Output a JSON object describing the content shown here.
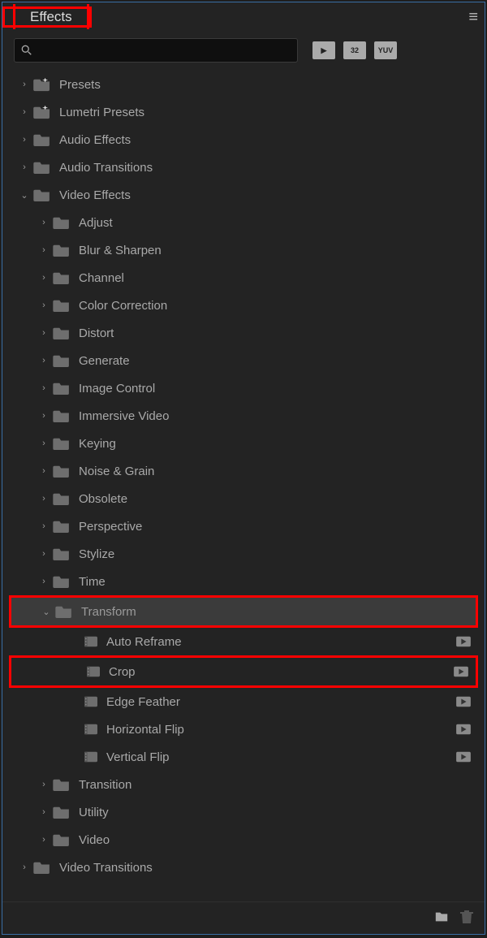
{
  "panel": {
    "title": "Effects"
  },
  "toolbar": {
    "search_value": "",
    "badges": {
      "fx": "▶",
      "b32": "32",
      "yuv": "YUV"
    }
  },
  "tree": {
    "presets": "Presets",
    "lumetri": "Lumetri Presets",
    "audio_effects": "Audio Effects",
    "audio_transitions": "Audio Transitions",
    "video_effects": "Video Effects",
    "ve": {
      "adjust": "Adjust",
      "blur": "Blur & Sharpen",
      "channel": "Channel",
      "color": "Color Correction",
      "distort": "Distort",
      "generate": "Generate",
      "image": "Image Control",
      "immersive": "Immersive Video",
      "keying": "Keying",
      "noise": "Noise & Grain",
      "obsolete": "Obsolete",
      "perspective": "Perspective",
      "stylize": "Stylize",
      "time": "Time",
      "transform": "Transform",
      "tf": {
        "auto_reframe": "Auto Reframe",
        "crop": "Crop",
        "edge_feather": "Edge Feather",
        "hflip": "Horizontal Flip",
        "vflip": "Vertical Flip"
      },
      "transition": "Transition",
      "utility": "Utility",
      "video": "Video"
    },
    "video_transitions": "Video Transitions"
  }
}
